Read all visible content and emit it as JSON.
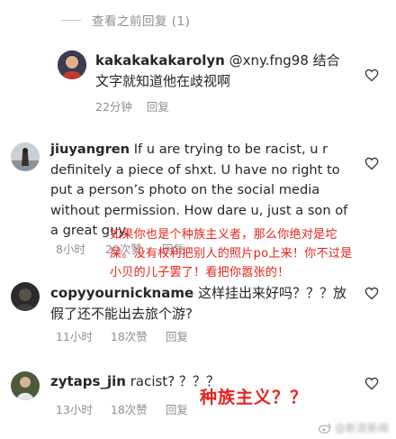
{
  "view_previous": "查看之前回复 (1)",
  "colors": {
    "overlay_red": "#e8221a",
    "meta_gray": "#8e8e8e"
  },
  "comments": [
    {
      "username": "kakakakakarolyn",
      "mention": "@xny.fng98",
      "text": "结合文字就知道他在歧视啊",
      "time": "22分钟",
      "likes": "",
      "reply": "回复"
    },
    {
      "username": "jiuyangren",
      "text": "If u are trying to be racist, u r definitely a piece of shxt. U have no right to put a person’s photo on the social media without permission. How dare u, just a son of a great guy.",
      "time": "8小时",
      "likes": "20次赞",
      "reply": "回复"
    },
    {
      "username": "copyyournickname",
      "text": "这样挂出来好吗？？？放假了还不能出去旅个游?",
      "time": "11小时",
      "likes": "18次赞",
      "reply": "回复"
    },
    {
      "username": "zytaps_jin",
      "text": "racist? ？？？",
      "time": "13小时",
      "likes": "18次赞",
      "reply": "回复"
    }
  ],
  "overlays": {
    "translation": "如果你也是个种族主义者，那么你绝对是坨屎。没有权利把别人的照片po上来！你不过是小贝的儿子罢了！看把你嚣张的！",
    "racism_label": "种族主义？？"
  },
  "watermark": "@新浪新闻"
}
